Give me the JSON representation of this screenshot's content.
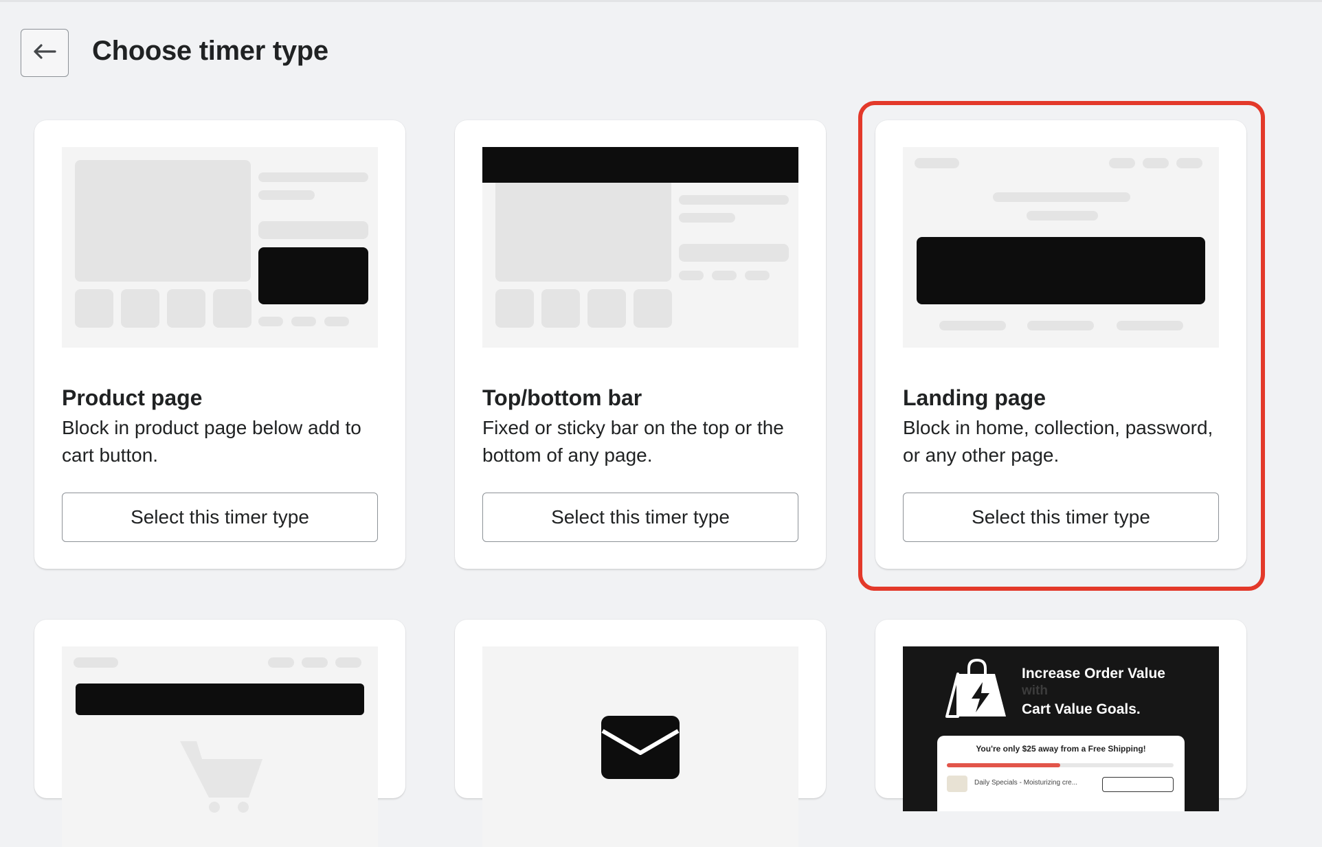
{
  "header": {
    "back_icon": "arrow-left-icon",
    "title": "Choose timer type"
  },
  "cards": [
    {
      "id": "product-page",
      "title": "Product page",
      "description": "Block in product page below add to cart button.",
      "button_label": "Select this timer type"
    },
    {
      "id": "top-bottom-bar",
      "title": "Top/bottom bar",
      "description": "Fixed or sticky bar on the top or the bottom of any page.",
      "button_label": "Select this timer type"
    },
    {
      "id": "landing-page",
      "title": "Landing page",
      "description": "Block in home, collection, password, or any other page.",
      "button_label": "Select this timer type",
      "highlighted": true
    },
    {
      "id": "cart-page",
      "preview_icon": "cart-icon"
    },
    {
      "id": "email",
      "preview_icon": "envelope-icon"
    },
    {
      "id": "cart-value-goals",
      "preview_icon": "shopping-bag-lightning-icon",
      "promo": {
        "line1": "Increase Order Value",
        "with": "with",
        "line3": "Cart Value Goals.",
        "shipping_text": "You're only $25 away from a Free Shipping!",
        "progress": 0.5,
        "item_text": "Daily Specials - Moisturizing cre..."
      }
    }
  ],
  "colors": {
    "background": "#f1f2f4",
    "card": "#ffffff",
    "preview_bg": "#f4f4f4",
    "preview_block": "#0d0d0d",
    "highlight_border": "#e3392a",
    "progress_fill": "#e2554a"
  }
}
